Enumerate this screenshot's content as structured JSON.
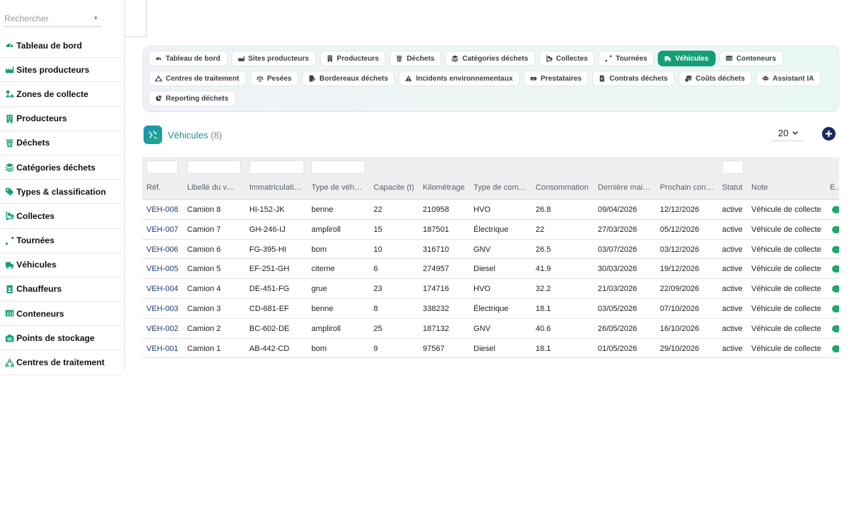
{
  "search": {
    "placeholder": "Rechercher"
  },
  "sidebar": {
    "items": [
      {
        "label": "Tableau de bord",
        "icon": "gauge-icon"
      },
      {
        "label": "Sites producteurs",
        "icon": "industry-icon"
      },
      {
        "label": "Zones de collecte",
        "icon": "map-zones-icon"
      },
      {
        "label": "Producteurs",
        "icon": "building-icon"
      },
      {
        "label": "Déchets",
        "icon": "trash-icon"
      },
      {
        "label": "Catégories déchets",
        "icon": "layers-icon"
      },
      {
        "label": "Types & classification",
        "icon": "tags-icon"
      },
      {
        "label": "Collectes",
        "icon": "dolly-icon"
      },
      {
        "label": "Tournées",
        "icon": "route-icon"
      },
      {
        "label": "Véhicules",
        "icon": "truck-icon"
      },
      {
        "label": "Chauffeurs",
        "icon": "id-badge-icon"
      },
      {
        "label": "Conteneurs",
        "icon": "container-icon"
      },
      {
        "label": "Points de stockage",
        "icon": "warehouse-icon"
      },
      {
        "label": "Centres de traitement",
        "icon": "recycle-icon"
      }
    ]
  },
  "tabs": [
    {
      "label": "Tableau de bord",
      "icon": "gauge-icon",
      "active": false
    },
    {
      "label": "Sites producteurs",
      "icon": "industry-icon",
      "active": false
    },
    {
      "label": "Producteurs",
      "icon": "building-icon",
      "active": false
    },
    {
      "label": "Déchets",
      "icon": "trash-icon",
      "active": false
    },
    {
      "label": "Catégories déchets",
      "icon": "layers-icon",
      "active": false
    },
    {
      "label": "Collectes",
      "icon": "dolly-icon",
      "active": false
    },
    {
      "label": "Tournées",
      "icon": "route-icon",
      "active": false
    },
    {
      "label": "Véhicules",
      "icon": "truck-icon",
      "active": true
    },
    {
      "label": "Conteneurs",
      "icon": "container-icon",
      "active": false
    },
    {
      "label": "Centres de traitement",
      "icon": "recycle-icon",
      "active": false
    },
    {
      "label": "Pesées",
      "icon": "scale-icon",
      "active": false
    },
    {
      "label": "Bordereaux déchets",
      "icon": "file-signature-icon",
      "active": false
    },
    {
      "label": "Incidents environnementaux",
      "icon": "warning-icon",
      "active": false
    },
    {
      "label": "Prestataires",
      "icon": "handshake-icon",
      "active": false
    },
    {
      "label": "Contrats déchets",
      "icon": "file-contract-icon",
      "active": false
    },
    {
      "label": "Coûts déchets",
      "icon": "coins-icon",
      "active": false
    },
    {
      "label": "Assistant IA",
      "icon": "robot-icon",
      "active": false
    },
    {
      "label": "Reporting déchets",
      "icon": "pie-chart-icon",
      "active": false
    }
  ],
  "page": {
    "title": "Véhicules",
    "count": "(8)",
    "per_page": "20"
  },
  "colors": {
    "accent": "#159f77",
    "link": "#1d3a7a",
    "add": "#1b2b5e",
    "status_on": "#20a868"
  },
  "table": {
    "headers": [
      "Réf.",
      "Libellé du véhicule",
      "Immatriculation",
      "Type de véhicule",
      "Capacite (t)",
      "Kilométrage",
      "Type de combustible",
      "Consommation",
      "Dernière maintenance",
      "Prochain contrôle",
      "Statut",
      "Note",
      "État"
    ],
    "rows": [
      [
        "VEH-008",
        "Camion 8",
        "HI-152-JK",
        "benne",
        "22",
        "210958",
        "HVO",
        "26.8",
        "09/04/2026",
        "12/12/2026",
        "active",
        "Véhicule de collecte"
      ],
      [
        "VEH-007",
        "Camion 7",
        "GH-246-IJ",
        "ampliroll",
        "15",
        "187501",
        "Électrique",
        "22",
        "27/03/2026",
        "05/12/2026",
        "active",
        "Véhicule de collecte"
      ],
      [
        "VEH-006",
        "Camion 6",
        "FG-395-HI",
        "bom",
        "10",
        "316710",
        "GNV",
        "26.5",
        "03/07/2026",
        "03/12/2026",
        "active",
        "Véhicule de collecte"
      ],
      [
        "VEH-005",
        "Camion 5",
        "EF-251-GH",
        "citerne",
        "6",
        "274957",
        "Diesel",
        "41.9",
        "30/03/2026",
        "19/12/2026",
        "active",
        "Véhicule de collecte"
      ],
      [
        "VEH-004",
        "Camion 4",
        "DE-451-FG",
        "grue",
        "23",
        "174716",
        "HVO",
        "32.2",
        "21/03/2026",
        "22/09/2026",
        "active",
        "Véhicule de collecte"
      ],
      [
        "VEH-003",
        "Camion 3",
        "CD-681-EF",
        "benne",
        "8",
        "338232",
        "Électrique",
        "18.1",
        "03/05/2026",
        "07/10/2026",
        "active",
        "Véhicule de collecte"
      ],
      [
        "VEH-002",
        "Camion 2",
        "BC-602-DE",
        "ampliroll",
        "25",
        "187132",
        "GNV",
        "40.6",
        "26/05/2026",
        "16/10/2026",
        "active",
        "Véhicule de collecte"
      ],
      [
        "VEH-001",
        "Camion 1",
        "AB-442-CD",
        "bom",
        "9",
        "97567",
        "Diesel",
        "18.1",
        "01/05/2026",
        "29/10/2026",
        "active",
        "Véhicule de collecte"
      ]
    ]
  }
}
